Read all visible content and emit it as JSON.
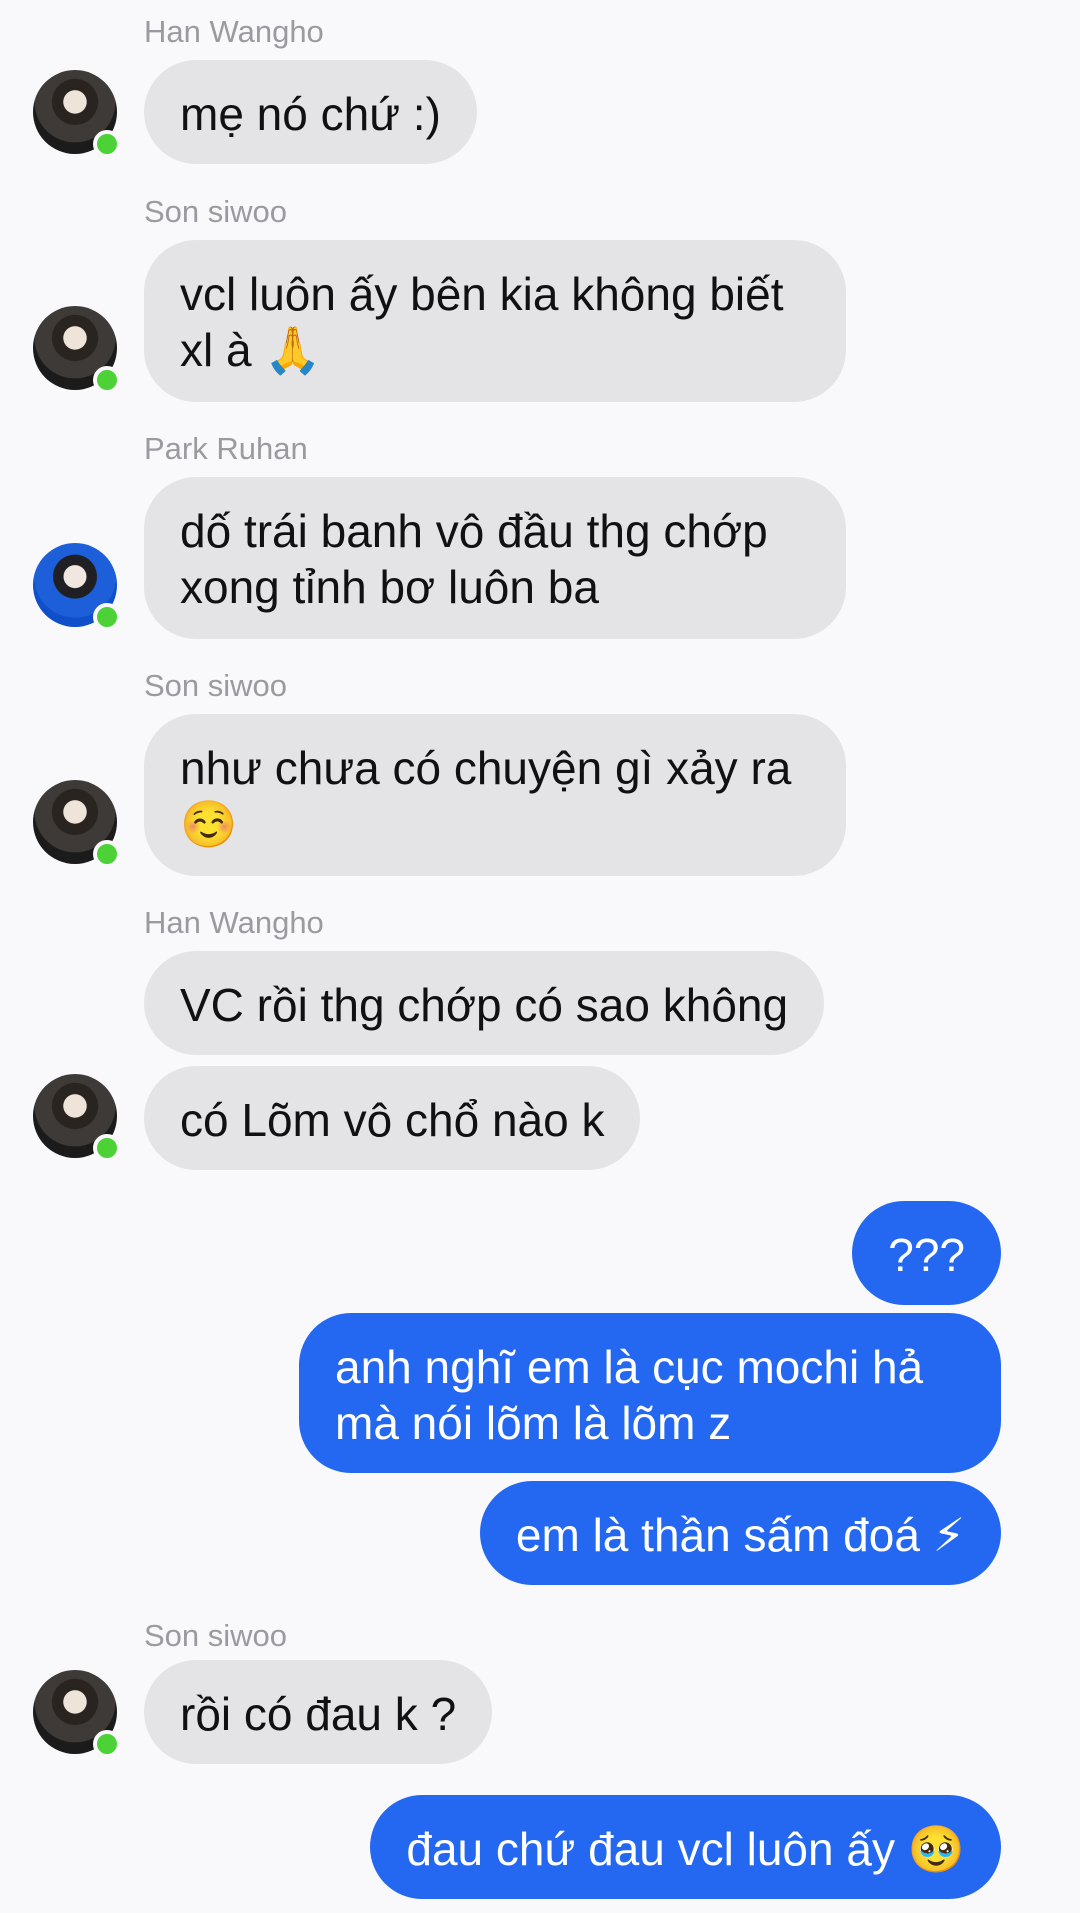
{
  "colors": {
    "incoming_bubble": "#e4e4e6",
    "outgoing_bubble": "#2468f2",
    "online": "#4cd137"
  },
  "messages": [
    {
      "sender": "Han Wangho",
      "text": "mẹ nó chứ :)"
    },
    {
      "sender": "Son siwoo",
      "text": "vcl luôn ấy bên kia không biết xl à 🙏"
    },
    {
      "sender": "Park Ruhan",
      "text": "dố trái banh vô đầu thg chớp xong tỉnh bơ luôn ba"
    },
    {
      "sender": "Son siwoo",
      "text": "như chưa có chuyện gì xảy ra ☺️"
    },
    {
      "sender": "Han Wangho",
      "text": "VC rồi thg chớp có sao không",
      "text2": "có Lõm vô chổ nào k"
    },
    {
      "text": "???"
    },
    {
      "text": "anh nghĩ em là cục mochi hả mà nói lõm là lõm z"
    },
    {
      "text": "em là thần sấm đoá ⚡"
    },
    {
      "sender": "Son siwoo",
      "text": "rồi có đau k ?"
    },
    {
      "text": "đau chứ đau vcl luôn ấy 🥹"
    }
  ]
}
